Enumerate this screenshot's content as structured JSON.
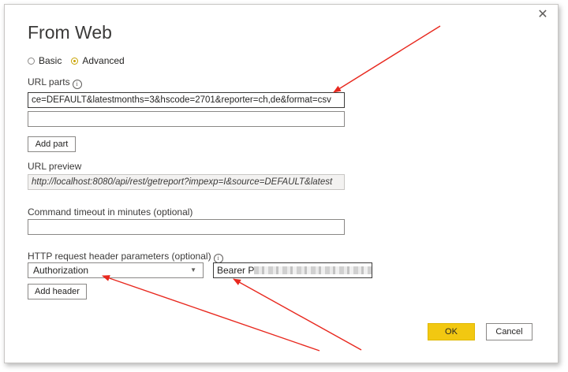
{
  "dialog": {
    "close_glyph": "✕",
    "title": "From Web",
    "mode": {
      "basic_label": "Basic",
      "advanced_label": "Advanced",
      "selected": "Advanced"
    },
    "url_parts": {
      "label": "URL parts",
      "info_glyph": "i",
      "part1_value": "ce=DEFAULT&latestmonths=3&hscode=2701&reporter=ch,de&format=csv",
      "part2_value": "",
      "add_part_label": "Add part"
    },
    "url_preview": {
      "label": "URL preview",
      "value": "http://localhost:8080/api/rest/getreport?impexp=I&source=DEFAULT&latest"
    },
    "timeout": {
      "label": "Command timeout in minutes (optional)",
      "value": ""
    },
    "headers": {
      "label": "HTTP request header parameters (optional)",
      "info_glyph": "i",
      "name_value": "Authorization",
      "value_prefix": "Bearer P",
      "value_suffix": "2",
      "add_header_label": "Add header"
    },
    "ok_label": "OK",
    "cancel_label": "Cancel"
  },
  "annotations": {
    "arrow_color": "#e8281e"
  },
  "colors": {
    "accent": "#f2c811",
    "radio_selected": "#c8a200"
  }
}
